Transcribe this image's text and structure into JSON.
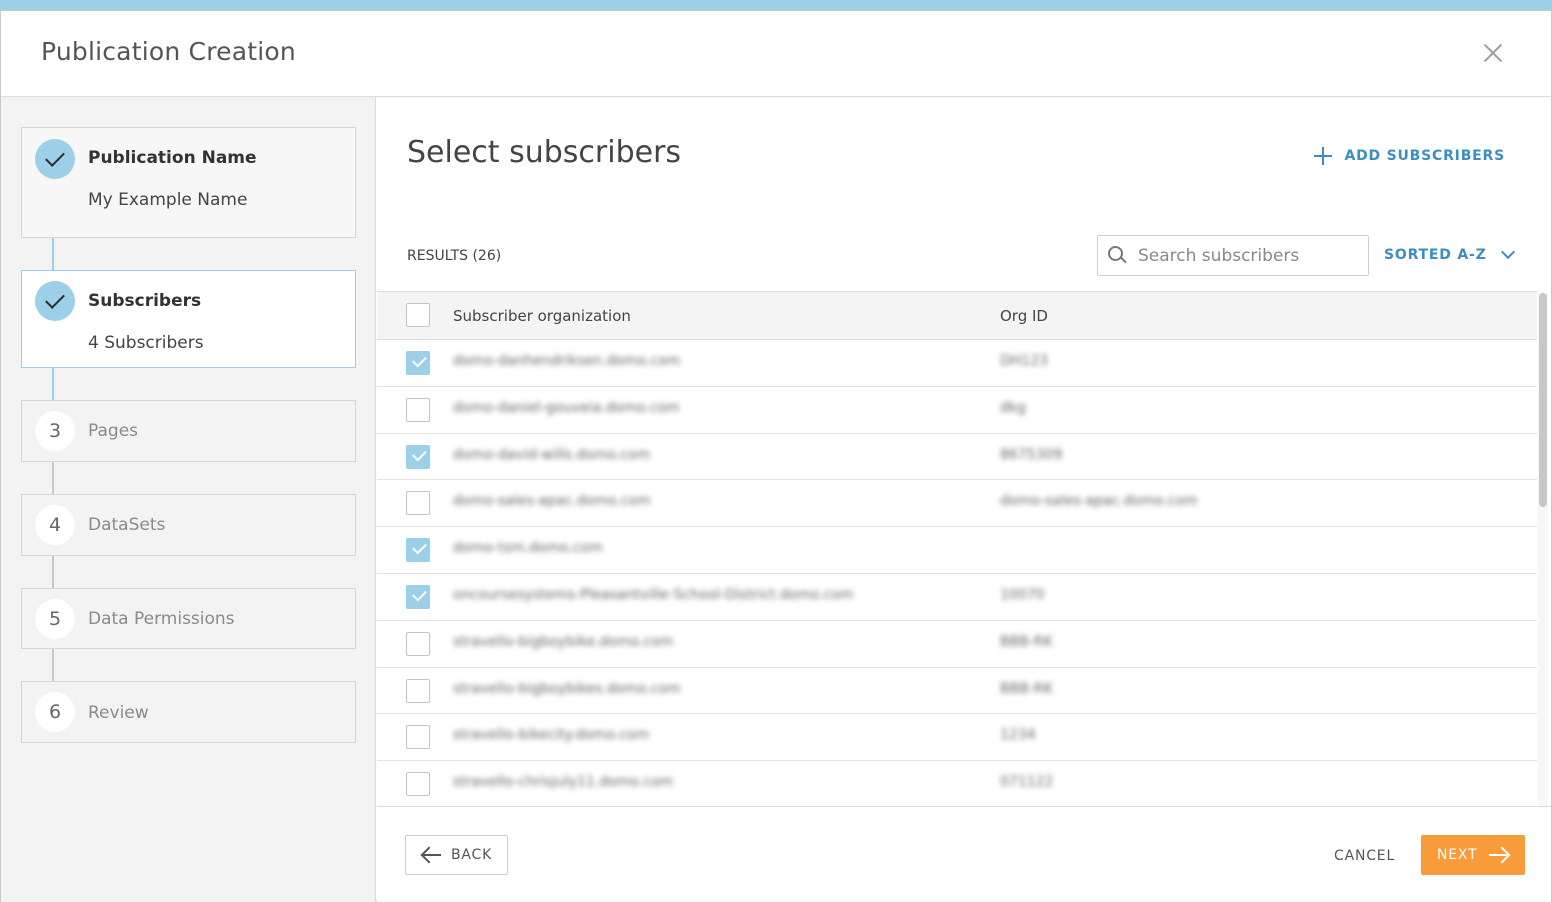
{
  "dialog": {
    "title": "Publication Creation"
  },
  "steps": [
    {
      "number": "1",
      "title": "Publication Name",
      "subtitle": "My Example Name",
      "state": "done"
    },
    {
      "number": "2",
      "title": "Subscribers",
      "subtitle": "4 Subscribers",
      "state": "active"
    },
    {
      "number": "3",
      "title": "Pages",
      "subtitle": "",
      "state": "upcoming"
    },
    {
      "number": "4",
      "title": "DataSets",
      "subtitle": "",
      "state": "upcoming"
    },
    {
      "number": "5",
      "title": "Data Permissions",
      "subtitle": "",
      "state": "upcoming"
    },
    {
      "number": "6",
      "title": "Review",
      "subtitle": "",
      "state": "upcoming"
    }
  ],
  "main": {
    "title": "Select subscribers",
    "add_label": "ADD SUBSCRIBERS",
    "results_label": "RESULTS (26)",
    "search_placeholder": "Search subscribers",
    "sort_label": "SORTED A-Z"
  },
  "table": {
    "columns": [
      "Subscriber organization",
      "Org ID"
    ],
    "rows": [
      {
        "org": "domo-danhendriksen.domo.com",
        "id": "DH123",
        "checked": true
      },
      {
        "org": "domo-daniel-gouveia.domo.com",
        "id": "dkg",
        "checked": false
      },
      {
        "org": "domo-david-wills.domo.com",
        "id": "8675309",
        "checked": true
      },
      {
        "org": "domo-sales-apac.domo.com",
        "id": "domo-sales-apac.domo.com",
        "checked": false
      },
      {
        "org": "domo-tsm.domo.com",
        "id": "",
        "checked": true
      },
      {
        "org": "oncoursesystems-Pleasantville-School-District.domo.com",
        "id": "10070",
        "checked": true
      },
      {
        "org": "stravello-bigboybike.domo.com",
        "id": "BBB-RK",
        "checked": false
      },
      {
        "org": "stravello-bigboybikes.domo.com",
        "id": "BBB-RK",
        "checked": false
      },
      {
        "org": "stravello-bikecity.domo.com",
        "id": "1234",
        "checked": false
      },
      {
        "org": "stravello-chrisjuly11.domo.com",
        "id": "071122",
        "checked": false
      },
      {
        "org": "",
        "id": "",
        "checked": false
      }
    ]
  },
  "footer": {
    "back_label": "BACK",
    "cancel_label": "CANCEL",
    "next_label": "NEXT"
  },
  "colors": {
    "accent": "#9ccfe8",
    "link": "#3b8ec2",
    "primary_button": "#f89b3b"
  }
}
